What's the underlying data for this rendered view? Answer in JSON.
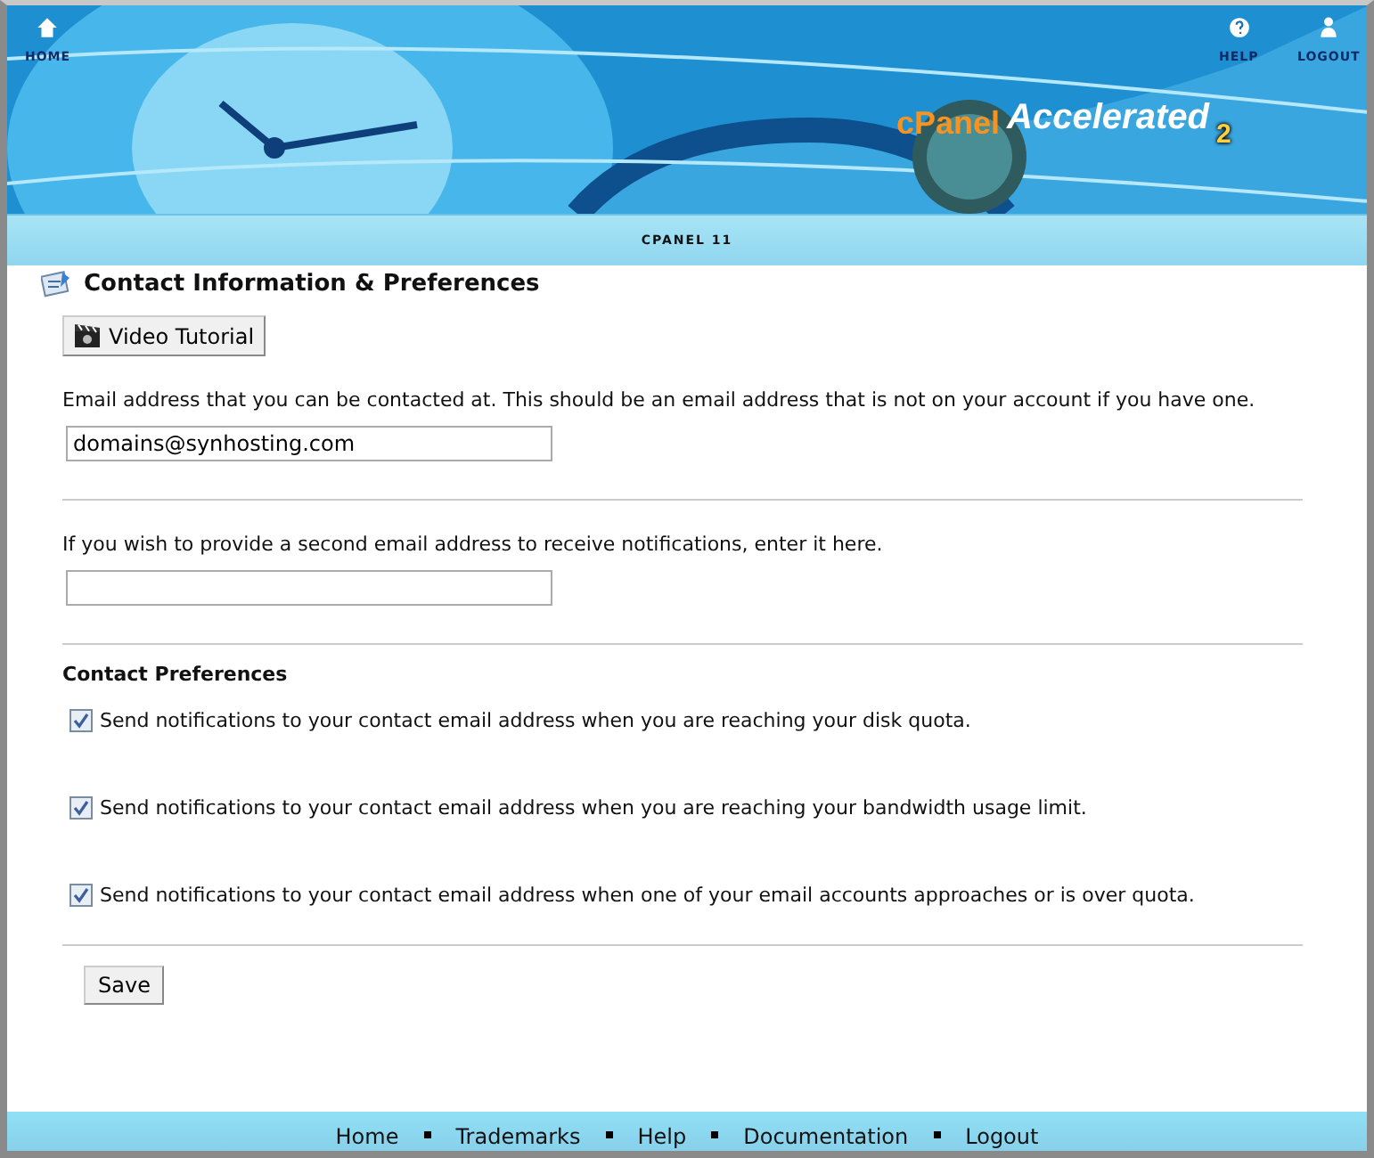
{
  "header": {
    "nav": [
      {
        "label": "HOME",
        "kind": "home"
      }
    ],
    "nav_right": [
      {
        "label": "HELP",
        "kind": "help"
      },
      {
        "label": "LOGOUT",
        "kind": "logout"
      }
    ],
    "logo": {
      "brand": "cPanel",
      "product": "Accelerated",
      "version": "2"
    },
    "band_label": "CPANEL 11"
  },
  "page": {
    "title": "Contact Information & Preferences",
    "video_button": "Video Tutorial",
    "primary_email": {
      "label": "Email address that you can be contacted at. This should be an email address that is not on your account if you have one.",
      "value": "domains@synhosting.com"
    },
    "secondary_email": {
      "label": "If you wish to provide a second email address to receive notifications, enter it here."
    },
    "preferences_heading": "Contact Preferences",
    "preferences": [
      {
        "label": "Send notifications to your contact email address when you are reaching your disk quota.",
        "checked": true
      },
      {
        "label": "Send notifications to your contact email address when you are reaching your bandwidth usage limit.",
        "checked": true
      },
      {
        "label": "Send notifications to your contact email address when one of your email accounts approaches or is over quota.",
        "checked": true
      }
    ],
    "save_button": "Save"
  },
  "footer": {
    "links": [
      "Home",
      "Trademarks",
      "Help",
      "Documentation",
      "Logout"
    ]
  }
}
